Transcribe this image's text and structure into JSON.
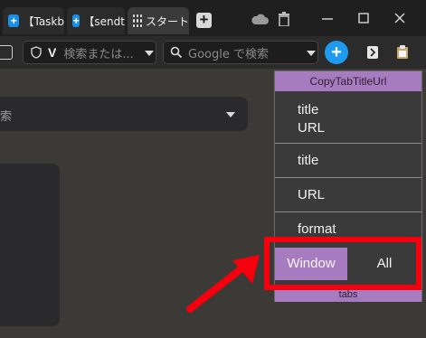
{
  "tabs": [
    {
      "label": "【Taskb",
      "favicon": "plus-blue"
    },
    {
      "label": "【sendt",
      "favicon": "plus-blue"
    },
    {
      "label": "スタート",
      "favicon": "grid"
    }
  ],
  "toolbar": {
    "address_placeholder": "検索または...",
    "search_placeholder": "Google で検索"
  },
  "page": {
    "search_partial": "索"
  },
  "popup": {
    "title": "CopyTabTitleUrl",
    "items": [
      "title\nURL",
      "title",
      "URL",
      "format"
    ],
    "segment": {
      "window": "Window",
      "all": "All"
    },
    "footer": "tabs"
  },
  "colors": {
    "accent": "#a77bbf",
    "highlight": "#f5000c",
    "addon_blue": "#1d9bf0"
  }
}
